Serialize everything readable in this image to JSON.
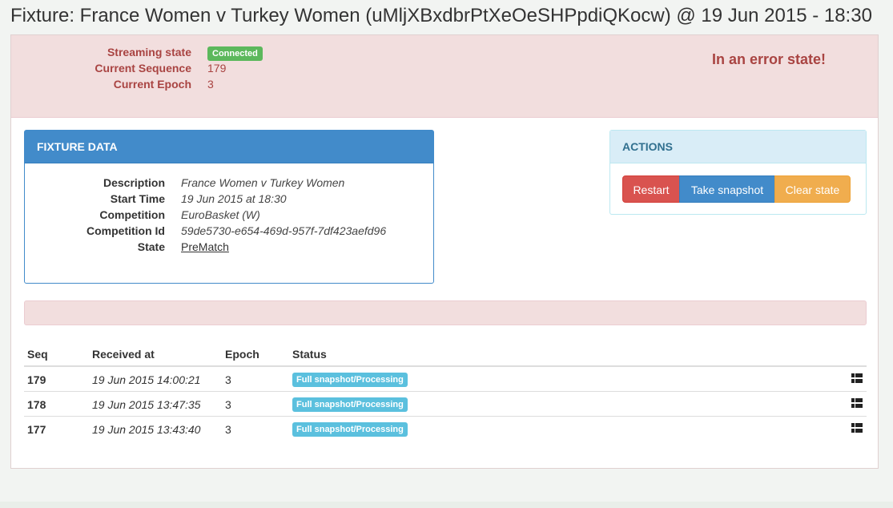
{
  "page": {
    "title": "Fixture: France Women v Turkey Women (uMljXBxdbrPtXeOeSHPpdiQKocw) @ 19 Jun 2015 - 18:30"
  },
  "state": {
    "streaming_state_label": "Streaming state",
    "streaming_state_value": "Connected",
    "current_sequence_label": "Current Sequence",
    "current_sequence_value": "179",
    "current_epoch_label": "Current Epoch",
    "current_epoch_value": "3",
    "error_message": "In an error state!"
  },
  "fixture_data": {
    "heading": "FIXTURE DATA",
    "rows": [
      {
        "label": "Description",
        "value": "France Women v Turkey Women"
      },
      {
        "label": "Start Time",
        "value": "19 Jun 2015 at 18:30"
      },
      {
        "label": "Competition",
        "value": "EuroBasket (W)"
      },
      {
        "label": "Competition Id",
        "value": "59de5730-e654-469d-957f-7df423aefd96"
      },
      {
        "label": "State",
        "value": "PreMatch"
      }
    ]
  },
  "actions": {
    "heading": "ACTIONS",
    "restart_label": "Restart",
    "snapshot_label": "Take snapshot",
    "clear_label": "Clear state"
  },
  "table": {
    "headers": [
      "Seq",
      "Received at",
      "Epoch",
      "Status"
    ],
    "rows": [
      {
        "seq": "179",
        "received_at": "19 Jun 2015 14:00:21",
        "epoch": "3",
        "status": "Full snapshot/Processing"
      },
      {
        "seq": "178",
        "received_at": "19 Jun 2015 13:47:35",
        "epoch": "3",
        "status": "Full snapshot/Processing"
      },
      {
        "seq": "177",
        "received_at": "19 Jun 2015 13:43:40",
        "epoch": "3",
        "status": "Full snapshot/Processing"
      }
    ]
  },
  "icons": {
    "row_action": "grid-icon"
  },
  "colors": {
    "danger_bg": "#f2dede",
    "danger_text": "#a94442",
    "primary": "#428bca",
    "success": "#5cb85c",
    "info": "#5bc0de",
    "warning": "#f0ad4e",
    "danger": "#d9534f"
  }
}
